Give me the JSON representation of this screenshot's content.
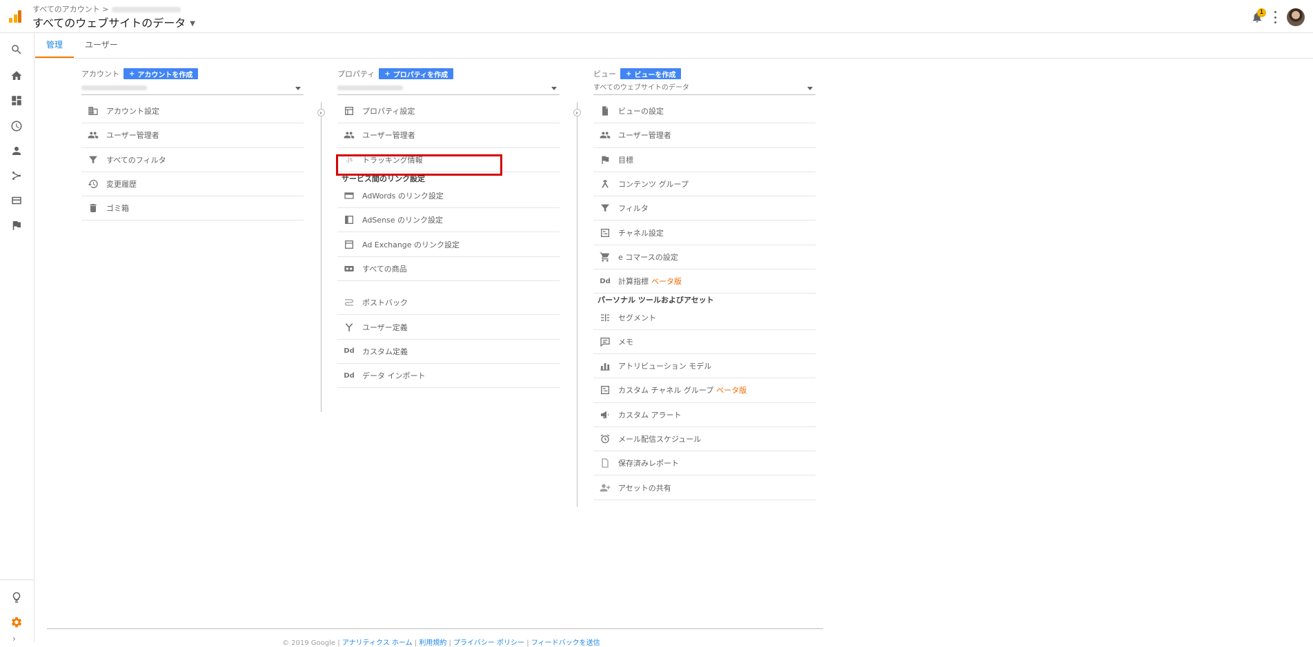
{
  "header": {
    "breadcrumb": "すべてのアカウント >",
    "property_title": "すべてのウェブサイトのデータ",
    "notification_count": "1"
  },
  "sidebar": {
    "icons": [
      "search-icon",
      "home-icon",
      "dashboard-icon",
      "clock-icon",
      "person-icon",
      "acquisition-icon",
      "behavior-icon",
      "flag-icon",
      "lightbulb-icon",
      "gear-icon"
    ]
  },
  "tabs": [
    {
      "label": "管理",
      "active": true
    },
    {
      "label": "ユーザー",
      "active": false
    }
  ],
  "account": {
    "label": "アカウント",
    "create_label": "アカウントを作成",
    "items": [
      {
        "label": "アカウント設定",
        "icon": "building-icon"
      },
      {
        "label": "ユーザー管理者",
        "icon": "people-icon"
      },
      {
        "label": "すべてのフィルタ",
        "icon": "filter-icon"
      },
      {
        "label": "変更履歴",
        "icon": "history-icon"
      },
      {
        "label": "ゴミ箱",
        "icon": "trash-icon"
      }
    ]
  },
  "property": {
    "label": "プロパティ",
    "create_label": "プロパティを作成",
    "items": [
      {
        "label": "プロパティ設定",
        "icon": "window-icon"
      },
      {
        "label": "ユーザー管理者",
        "icon": "people-icon"
      },
      {
        "label": "トラッキング情報",
        "icon": "js-icon",
        "glyph": ".js"
      }
    ],
    "link_heading": "サービス間のリンク設定",
    "link_items": [
      {
        "label": "AdWords のリンク設定",
        "icon": "adwords-icon"
      },
      {
        "label": "AdSense のリンク設定",
        "icon": "adsense-icon"
      },
      {
        "label": "Ad Exchange のリンク設定",
        "icon": "adexchange-icon"
      },
      {
        "label": "すべての商品",
        "icon": "products-icon"
      }
    ],
    "other_items": [
      {
        "label": "ポストバック",
        "icon": "postback-icon"
      },
      {
        "label": "ユーザー定義",
        "icon": "fork-icon"
      },
      {
        "label": "カスタム定義",
        "icon": "dd-icon",
        "glyph": "Dd"
      },
      {
        "label": "データ インポート",
        "icon": "dd-icon",
        "glyph": "Dd"
      }
    ]
  },
  "view": {
    "label": "ビュー",
    "create_label": "ビューを作成",
    "selected": "すべてのウェブサイトのデータ",
    "items": [
      {
        "label": "ビューの設定",
        "icon": "document-icon"
      },
      {
        "label": "ユーザー管理者",
        "icon": "people-icon"
      },
      {
        "label": "目標",
        "icon": "flag-icon"
      },
      {
        "label": "コンテンツ グループ",
        "icon": "content-group-icon"
      },
      {
        "label": "フィルタ",
        "icon": "filter-icon"
      },
      {
        "label": "チャネル設定",
        "icon": "channel-icon"
      },
      {
        "label": "e コマースの設定",
        "icon": "cart-icon"
      },
      {
        "label": "計算指標",
        "icon": "dd-icon",
        "glyph": "Dd",
        "beta": "ベータ版"
      }
    ],
    "personal_heading": "パーソナル ツールおよびアセット",
    "personal_items": [
      {
        "label": "セグメント",
        "icon": "segment-icon"
      },
      {
        "label": "メモ",
        "icon": "note-icon"
      },
      {
        "label": "アトリビューション モデル",
        "icon": "bar-chart-icon"
      },
      {
        "label": "カスタム チャネル グループ",
        "icon": "channel-icon",
        "beta": "ベータ版"
      },
      {
        "label": "カスタム アラート",
        "icon": "megaphone-icon"
      },
      {
        "label": "メール配信スケジュール",
        "icon": "alarm-icon"
      },
      {
        "label": "保存済みレポート",
        "icon": "saved-report-icon"
      },
      {
        "label": "アセットの共有",
        "icon": "share-person-icon"
      }
    ]
  },
  "footer": {
    "copyright": "© 2019 Google |",
    "links": [
      "アナリティクス ホーム",
      "利用規約",
      "プライバシー ポリシー",
      "フィードバックを送信"
    ]
  }
}
